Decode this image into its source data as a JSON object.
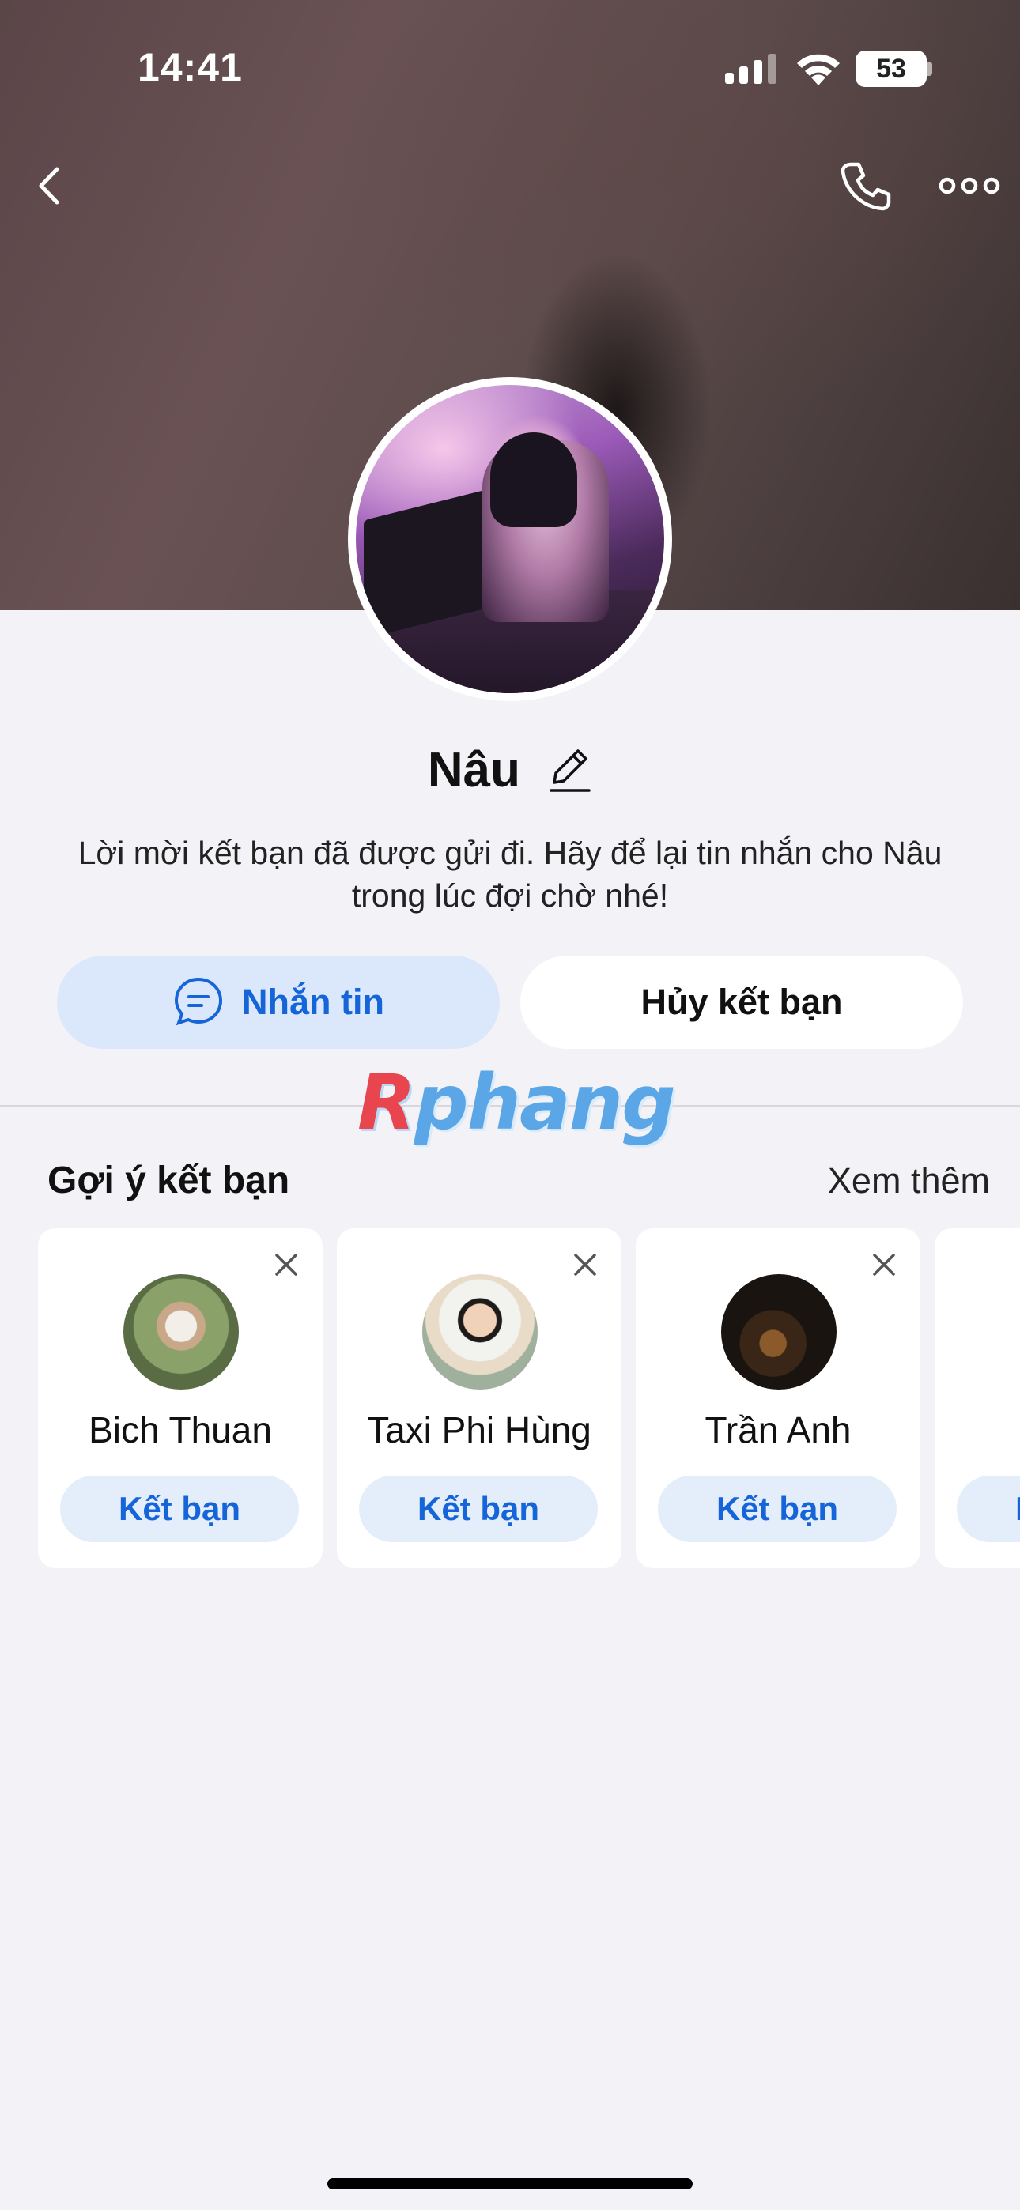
{
  "status_bar": {
    "time": "14:41",
    "battery": "53"
  },
  "header": {
    "icons": [
      "back-icon",
      "phone-icon",
      "more-icon"
    ]
  },
  "profile": {
    "name": "Nâu",
    "message": "Lời mời kết bạn đã được gửi đi. Hãy để lại tin nhắn cho Nâu trong lúc đợi chờ nhé!",
    "message_button": "Nhắn tin",
    "cancel_button": "Hủy kết bạn"
  },
  "watermark": {
    "first": "R",
    "rest": "phang"
  },
  "suggestions": {
    "title": "Gợi ý kết bạn",
    "see_more": "Xem thêm",
    "items": [
      {
        "name": "Bich Thuan",
        "action": "Kết bạn"
      },
      {
        "name": "Taxi Phi Hùng",
        "action": "Kết bạn"
      },
      {
        "name": "Trần Anh",
        "action": "Kết bạn"
      },
      {
        "name": "",
        "action": "Kết bạn"
      }
    ]
  },
  "colors": {
    "accent": "#1665d8",
    "accent_bg": "#dbe8fb",
    "page_bg": "#f2f2f7"
  }
}
